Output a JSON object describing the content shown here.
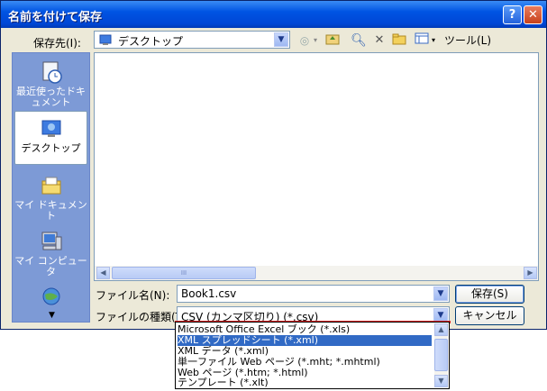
{
  "window": {
    "title": "名前を付けて保存",
    "help_glyph": "?",
    "close_glyph": "✕"
  },
  "save_in": {
    "label": "保存先(I):",
    "value": "デスクトップ"
  },
  "toolbar": {
    "tools_label": "ツール(L)"
  },
  "places": [
    {
      "label": "最近使ったドキュメント"
    },
    {
      "label": "デスクトップ"
    },
    {
      "label": "マイ ドキュメント"
    },
    {
      "label": "マイ コンピュータ"
    },
    {
      "label": ""
    }
  ],
  "file_name": {
    "label": "ファイル名(N):",
    "value": "Book1.csv"
  },
  "file_type": {
    "label": "ファイルの種類(T):",
    "value": "CSV (カンマ区切り) (*.csv)",
    "options": [
      "Microsoft Office Excel ブック (*.xls)",
      "XML スプレッドシート (*.xml)",
      "XML データ (*.xml)",
      "単一ファイル Web ページ (*.mht; *.mhtml)",
      "Web ページ (*.htm; *.html)",
      "テンプレート (*.xlt)"
    ],
    "selected_index": 1
  },
  "buttons": {
    "save": "保存(S)",
    "cancel": "キャンセル"
  },
  "scroll_thumb_glyph": "III"
}
